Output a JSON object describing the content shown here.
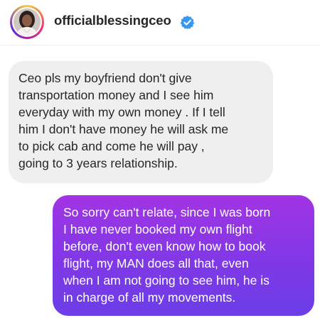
{
  "header": {
    "username": "officialblessingceo",
    "avatar_icon": "profile-avatar",
    "verified_icon": "verified-badge-icon",
    "verified_color": "#3897f0",
    "avatar_ring_colors": [
      "#f9ce34",
      "#ee2a7b",
      "#6228d7"
    ]
  },
  "messages": [
    {
      "sender": "other",
      "text": "Ceo pls my boyfriend don't give\ntransportation money and I see him\neveryday with my own money . If I tell\nhim I don't have money he will ask me\nto pick cab and come he will pay ,\ngoing to 3 years relationship.",
      "bubble_color": "#efefef"
    },
    {
      "sender": "me",
      "text": "So sorry can't relate, since I was born\nI have never booked my own flight\nbefore, don't even know how to book\nflight, my MAN does all that, even\nwhen I am not going to see him, he is\nin charge of all my movements.",
      "bubble_color": "#8a36e5"
    }
  ]
}
